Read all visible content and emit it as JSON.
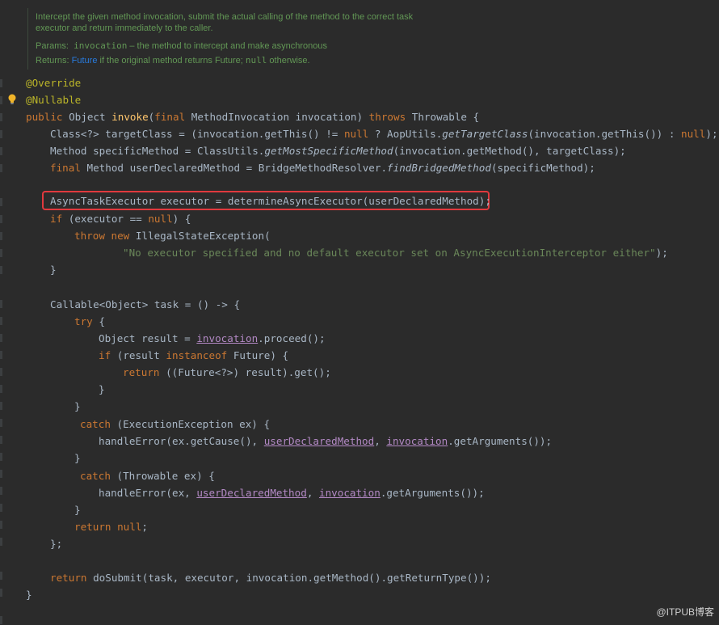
{
  "doc": {
    "line1": "Intercept the given method invocation, submit the actual calling of the method to the correct task",
    "line2": "executor and return immediately to the caller.",
    "params_label": "Params:",
    "params_code": "invocation",
    "params_text": " – the method to intercept and make asynchronous",
    "returns_label": "Returns:",
    "returns_link": "Future",
    "returns_text1": " if the original method returns Future; ",
    "returns_code": "null",
    "returns_text2": " otherwise."
  },
  "code": {
    "l1": "@Override",
    "l2": "@Nullable",
    "l3_kw1": "public",
    "l3_a": " Object ",
    "l3_fn": "invoke",
    "l3_b": "(",
    "l3_kw2": "final",
    "l3_c": " MethodInvocation invocation) ",
    "l3_kw3": "throws",
    "l3_d": " Throwable {",
    "l4_a": "Class<?> targetClass = (invocation.getThis() != ",
    "l4_kw": "null",
    "l4_b": " ? AopUtils.",
    "l4_it": "getTargetClass",
    "l4_c": "(invocation.getThis()) : ",
    "l4_kw2": "null",
    "l4_d": ");",
    "l5_a": "Method specificMethod = ClassUtils.",
    "l5_it": "getMostSpecificMethod",
    "l5_b": "(invocation.getMethod(), targetClass);",
    "l6_kw": "final",
    "l6_a": " Method userDeclaredMethod = BridgeMethodResolver.",
    "l6_it": "findBridgedMethod",
    "l6_b": "(specificMethod);",
    "l7": "AsyncTaskExecutor executor = determineAsyncExecutor(userDeclaredMethod);",
    "l8_kw": "if",
    "l8_a": " (executor == ",
    "l8_kw2": "null",
    "l8_b": ") {",
    "l9_kw1": "throw",
    "l9_kw2": " new",
    "l9_a": " IllegalStateException(",
    "l10_str": "\"No executor specified and no default executor set on AsyncExecutionInterceptor either\"",
    "l10_a": ");",
    "l11": "}",
    "l12": "Callable<Object> task = () -> {",
    "l13_kw": "try",
    "l13_a": " {",
    "l14_a": "Object result = ",
    "l14_ul": "invocation",
    "l14_b": ".proceed();",
    "l15_kw": "if",
    "l15_a": " (result ",
    "l15_kw2": "instanceof",
    "l15_b": " Future) {",
    "l16_kw": "return",
    "l16_a": " ((Future<?>) result).get();",
    "l17": "}",
    "l18": "}",
    "l19_kw": "catch",
    "l19_a": " (ExecutionException ex) {",
    "l20_a": "handleError(ex.getCause(), ",
    "l20_ul1": "userDeclaredMethod",
    "l20_b": ", ",
    "l20_ul2": "invocation",
    "l20_c": ".getArguments());",
    "l21": "}",
    "l22_kw": "catch",
    "l22_a": " (Throwable ex) {",
    "l23_a": "handleError(ex, ",
    "l23_ul1": "userDeclaredMethod",
    "l23_b": ", ",
    "l23_ul2": "invocation",
    "l23_c": ".getArguments());",
    "l24": "}",
    "l25_kw": "return",
    "l25_kw2": " null",
    "l25_a": ";",
    "l26": "};",
    "l27_kw": "return",
    "l27_a": " doSubmit(task, executor, invocation.getMethod().getReturnType());",
    "l28": "}"
  },
  "watermark": "@ITPUB博客",
  "colors": {
    "background": "#2b2b2b",
    "keyword": "#cc7832",
    "annotation": "#bbb529",
    "string": "#6a8759",
    "method_decl": "#ffc66d",
    "default_text": "#a9b7c6",
    "field_underline": "#b389c5",
    "doc_comment": "#629755",
    "highlight_border": "#e0393e"
  },
  "icons": [
    "lightbulb-icon"
  ]
}
